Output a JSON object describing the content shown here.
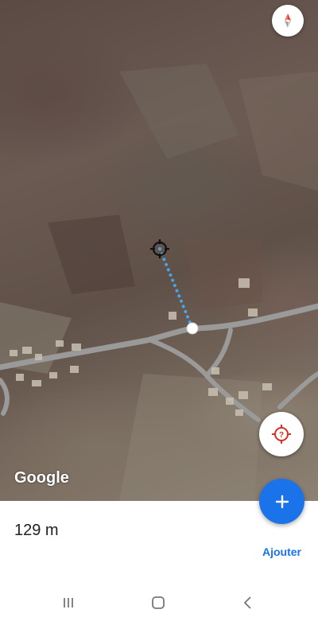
{
  "map": {
    "attribution": "Google",
    "compass_icon": "compass-icon",
    "locate_icon": "location-question-icon"
  },
  "measurement": {
    "distance": "129 m",
    "add_label": "Ajouter",
    "add_icon": "plus-icon"
  },
  "colors": {
    "accent": "#1a73e8",
    "measure_line": "#4aa3e8",
    "road": "#9a9a9a"
  },
  "navbar": {
    "recents_icon": "recents-icon",
    "home_icon": "home-icon",
    "back_icon": "back-icon"
  }
}
